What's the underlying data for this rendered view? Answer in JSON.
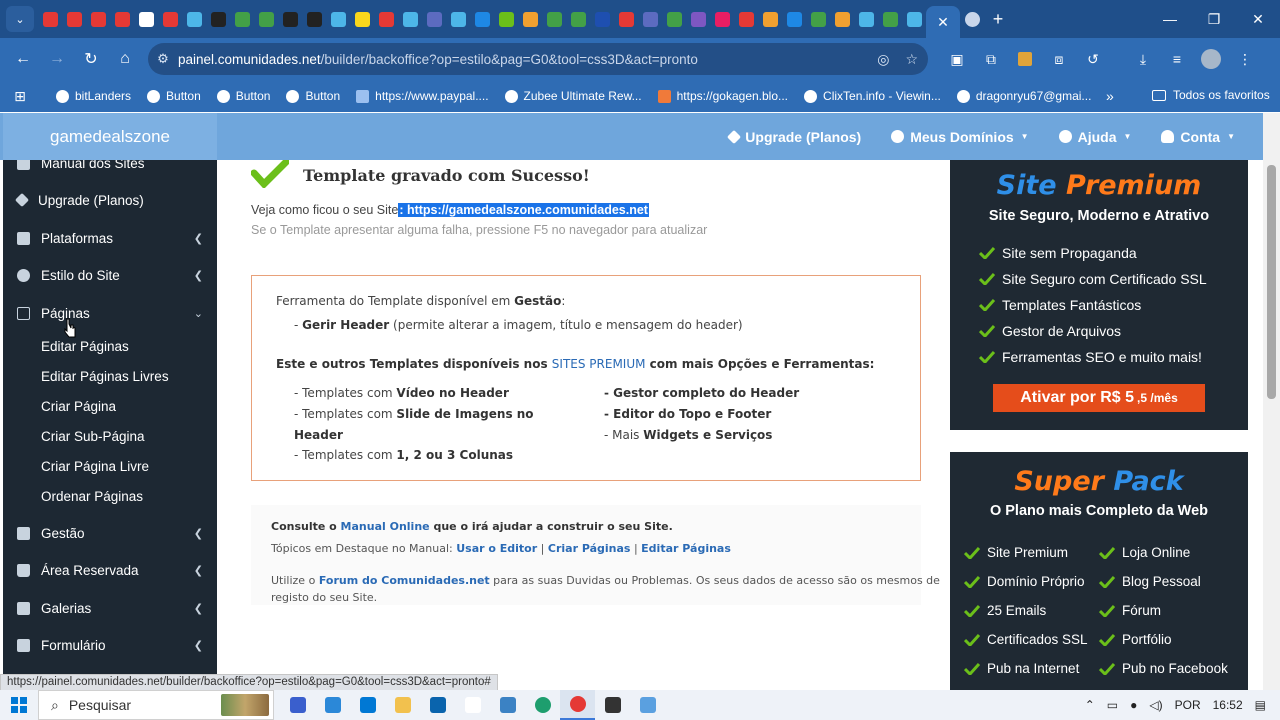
{
  "browser": {
    "url_host": "painel.comunidades.net",
    "url_path": "/builder/backoffice?op=estilo&pag=G0&tool=css3D&act=pronto",
    "bookmarks": [
      "bitLanders",
      "Button",
      "Button",
      "Button",
      "https://www.paypal....",
      "Zubee Ultimate Rew...",
      "https://gokagen.blo...",
      "ClixTen.info - Viewin...",
      "dragonryu67@gmai..."
    ],
    "bookmarks_folder": "Todos os favoritos",
    "status_url": "https://painel.comunidades.net/builder/backoffice?op=estilo&pag=G0&tool=css3D&act=pronto#"
  },
  "site": {
    "brand": "gamedealszone",
    "nav": {
      "upgrade": "Upgrade (Planos)",
      "dominios": "Meus Domínios",
      "ajuda": "Ajuda",
      "conta": "Conta"
    }
  },
  "sidebar": {
    "items": [
      {
        "label": "Manual dos Sites"
      },
      {
        "label": "Upgrade (Planos)"
      },
      {
        "label": "Plataformas"
      },
      {
        "label": "Estilo do Site"
      },
      {
        "label": "Páginas"
      },
      {
        "label": "Gestão"
      },
      {
        "label": "Área Reservada"
      },
      {
        "label": "Galerias"
      },
      {
        "label": "Formulário"
      }
    ],
    "subitems": [
      "Editar Páginas",
      "Editar Páginas Livres",
      "Criar Página",
      "Criar Sub-Página",
      "Criar Página Livre",
      "Ordenar Páginas"
    ]
  },
  "main": {
    "success_title": "Template gravado com Sucesso!",
    "see_text": "Veja como ficou o seu Site",
    "see_link": ": https://gamedealszone.comunidades.net",
    "f5_text": "Se o Template apresentar alguma falha, pressione F5 no navegador para atualizar",
    "toolbox": {
      "avail_prefix": "Ferramenta do Template disponível em ",
      "avail_bold": "Gestão",
      "avail_suffix": ":",
      "gerir_bold": "Gerir Header",
      "gerir_rest": " (permite alterar a imagem, título e mensagem do header)",
      "outros_1": "Este e outros Templates disponíveis nos ",
      "outros_link": "SITES PREMIUM",
      "outros_2": " com mais Opções e Ferramentas:",
      "l1_pre": "- Templates com ",
      "l1_bold": "Vídeo no Header",
      "l2_pre": "- Templates com ",
      "l2_bold": "Slide de Imagens no",
      "l2b_bold": "Header",
      "l3_pre": "- Templates com ",
      "l3_bold": "1, 2 ou 3 Colunas",
      "r1": "- Gestor completo do Header",
      "r2": "- Editor do Topo e Footer",
      "r3_pre": "- Mais ",
      "r3_bold": "Widgets e Serviços"
    },
    "consult": {
      "c1_pre": "Consulte o ",
      "c1_link": "Manual Online",
      "c1_post": " que o irá ajudar a construir o seu Site.",
      "c2_pre": "Tópicos em Destaque no Manual: ",
      "c2_a": "Usar o Editor",
      "c2_b": "Criar Páginas",
      "c2_c": "Editar Páginas",
      "sep": " | ",
      "c3_pre": "Utilize o ",
      "c3_link": "Forum do Comunidades.net",
      "c3_post": " para as suas Duvidas ou Problemas. Os seus dados de acesso são os mesmos de",
      "c4": "registo do seu Site."
    }
  },
  "promo_premium": {
    "title": "Site Premium",
    "subtitle": "Site Seguro, Moderno e Atrativo",
    "features": [
      "Site sem Propaganda",
      "Site Seguro com Certificado SSL",
      "Templates Fantásticos",
      "Gestor de Arquivos",
      "Ferramentas SEO e muito mais!"
    ],
    "cta": "Ativar por R$ 5",
    "cta_small": ",5 /mês"
  },
  "promo_superpack": {
    "title": "Super Pack",
    "subtitle": "O Plano mais Completo da Web",
    "col1": [
      "Site Premium",
      "Domínio Próprio",
      "25 Emails",
      "Certificados SSL",
      "Pub na Internet"
    ],
    "col2": [
      "Loja Online",
      "Blog Pessoal",
      "Fórum",
      "Portfólio",
      "Pub no Facebook"
    ]
  },
  "taskbar": {
    "search": "Pesquisar",
    "lang": "POR",
    "time": "16:52"
  },
  "colors": {
    "accent_orange": "#ff7a1a",
    "accent_blue": "#2f8fe8",
    "check_green": "#6bbf1a"
  }
}
